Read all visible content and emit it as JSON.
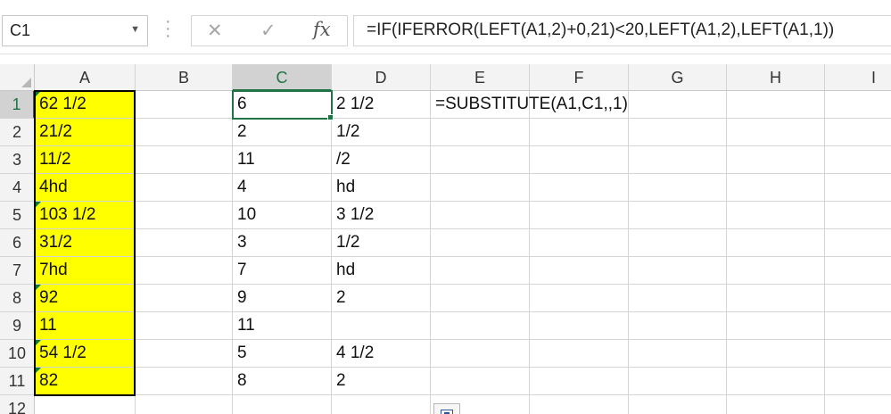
{
  "formula_bar": {
    "name_box": "C1",
    "formula": "=IF(IFERROR(LEFT(A1,2)+0,21)<20,LEFT(A1,2),LEFT(A1,1))",
    "cancel_icon": "close-icon",
    "enter_icon": "check-icon",
    "fx_label": "fx"
  },
  "columns": [
    "A",
    "B",
    "C",
    "D",
    "E",
    "F",
    "G",
    "H",
    "I"
  ],
  "selected_column": "C",
  "rows": [
    "1",
    "2",
    "3",
    "4",
    "5",
    "6",
    "7",
    "8",
    "9",
    "10",
    "11",
    "12"
  ],
  "selected_row": "1",
  "cells": {
    "A": [
      "62 1/2",
      "21/2",
      "11/2",
      "4hd",
      "103 1/2",
      "31/2",
      "7hd",
      "92",
      "11",
      "54 1/2",
      "82"
    ],
    "C": [
      "6",
      "2",
      "11",
      "4",
      "10",
      "3",
      "7",
      "9",
      "11",
      "5",
      "8"
    ],
    "D": [
      "2 1/2",
      "1/2",
      "/2",
      "hd",
      "3 1/2",
      "1/2",
      "hd",
      "2",
      "",
      "4 1/2",
      "2"
    ],
    "E1": "=SUBSTITUTE(A1,C1,,1)"
  },
  "colors": {
    "highlight": "#ffff00",
    "excel_green": "#217346",
    "header_bg": "#f3f3f3"
  }
}
